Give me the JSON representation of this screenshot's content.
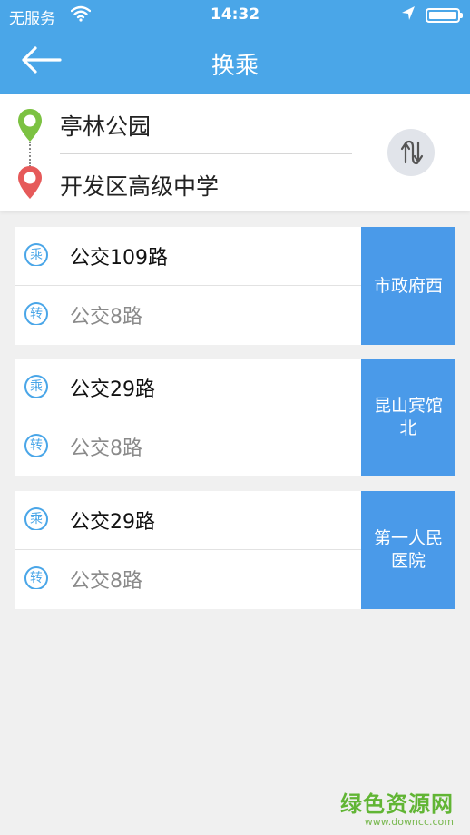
{
  "status_bar": {
    "carrier": "无服务",
    "time": "14:32"
  },
  "header": {
    "title": "换乘",
    "back_icon": "arrow-left-icon"
  },
  "route": {
    "from": "亭林公园",
    "to": "开发区高级中学",
    "swap_icon": "swap-vertical-icon"
  },
  "options": [
    {
      "board_badge": "乘",
      "board_line": "公交109路",
      "transfer_badge": "转",
      "transfer_line": "公交8路",
      "transfer_stop": "市政府西"
    },
    {
      "board_badge": "乘",
      "board_line": "公交29路",
      "transfer_badge": "转",
      "transfer_line": "公交8路",
      "transfer_stop": "昆山宾馆北"
    },
    {
      "board_badge": "乘",
      "board_line": "公交29路",
      "transfer_badge": "转",
      "transfer_line": "公交8路",
      "transfer_stop": "第一人民医院"
    }
  ],
  "watermark": {
    "main": "绿色资源网",
    "sub": "www.downcc.com"
  },
  "colors": {
    "header": "#4aa6e8",
    "stop_box": "#4a9ae9",
    "pin_start": "#7cc242",
    "pin_end": "#e65a5a"
  }
}
